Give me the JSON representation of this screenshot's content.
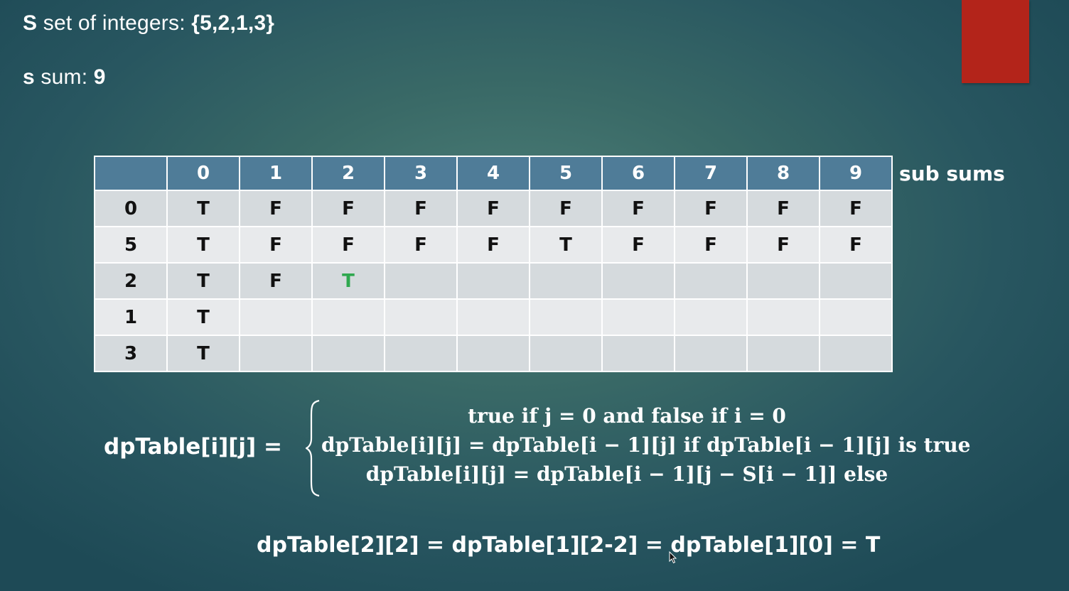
{
  "header": {
    "set_letter": "S",
    "set_label": " set of integers: ",
    "set_value": "{5,2,1,3}",
    "sum_letter": "s",
    "sum_label": " sum: ",
    "sum_value": "9"
  },
  "table": {
    "corner": "",
    "columns": [
      "0",
      "1",
      "2",
      "3",
      "4",
      "5",
      "6",
      "7",
      "8",
      "9"
    ],
    "side_label": "sub sums",
    "rows": [
      {
        "label": "0",
        "cells": [
          "T",
          "F",
          "F",
          "F",
          "F",
          "F",
          "F",
          "F",
          "F",
          "F"
        ]
      },
      {
        "label": "5",
        "cells": [
          "T",
          "F",
          "F",
          "F",
          "F",
          "T",
          "F",
          "F",
          "F",
          "F"
        ]
      },
      {
        "label": "2",
        "cells": [
          "T",
          "F",
          "T",
          "",
          "",
          "",
          "",
          "",
          "",
          ""
        ]
      },
      {
        "label": "1",
        "cells": [
          "T",
          "",
          "",
          "",
          "",
          "",
          "",
          "",
          "",
          ""
        ]
      },
      {
        "label": "3",
        "cells": [
          "T",
          "",
          "",
          "",
          "",
          "",
          "",
          "",
          "",
          ""
        ]
      }
    ],
    "highlighted_cell": {
      "row": 2,
      "col": 2,
      "color": "#2fa84f"
    }
  },
  "formula": {
    "lhs": "dpTable[i][j] =",
    "cases": [
      "true if j = 0 and false if i = 0",
      "dpTable[i][j] = dpTable[i − 1][j]  if dpTable[i − 1][j] is true",
      "dpTable[i][j] = dpTable[i − 1][j − S[i − 1]]   else"
    ]
  },
  "example": "dpTable[2][2] = dpTable[1][2-2] = dpTable[1][0] = T",
  "colors": {
    "accent_block": "#b3241a",
    "header_row": "#4f7c98",
    "row_dark": "#d5dadd",
    "row_light": "#e8eaec",
    "highlight": "#2fa84f"
  }
}
